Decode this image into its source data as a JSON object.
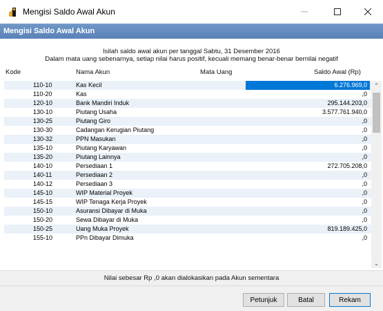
{
  "window": {
    "title": "Mengisi Saldo Awal Akun"
  },
  "header": {
    "title": "Mengisi Saldo Awal Akun"
  },
  "instructions": {
    "line1": "Isilah saldo awal akun per tanggal Sabtu, 31 Desember 2016",
    "line2": "Dalam mata uang sebenarnya, setiap nilai harus positif, kecuali memang benar-benar bernilai negatif"
  },
  "table": {
    "columns": {
      "kode": "Kode",
      "nama": "Nama Akun",
      "mata_uang": "Mata Uang",
      "saldo": "Saldo Awal (Rp)"
    },
    "rows": [
      {
        "kode": "110-10",
        "nama": "Kas Kecil",
        "saldo": "6.276.969,0"
      },
      {
        "kode": "110-20",
        "nama": "Kas",
        "saldo": ",0"
      },
      {
        "kode": "120-10",
        "nama": "Bank Mandiri Induk",
        "saldo": "295.144.203,0"
      },
      {
        "kode": "130-10",
        "nama": "Piutang Usaha",
        "saldo": "3.577.761.940,0"
      },
      {
        "kode": "130-25",
        "nama": "Piutang Giro",
        "saldo": ",0"
      },
      {
        "kode": "130-30",
        "nama": "Cadangan Kerugian Piutang",
        "saldo": ",0"
      },
      {
        "kode": "130-32",
        "nama": "PPN Masukan",
        "saldo": ",0"
      },
      {
        "kode": "135-10",
        "nama": "Piutang Karyawan",
        "saldo": ",0"
      },
      {
        "kode": "135-20",
        "nama": "Piutang Lainnya",
        "saldo": ",0"
      },
      {
        "kode": "140-10",
        "nama": "Persediaan 1",
        "saldo": "272.705.208,0"
      },
      {
        "kode": "140-11",
        "nama": "Persediaan 2",
        "saldo": ",0"
      },
      {
        "kode": "140-12",
        "nama": "Persediaan 3",
        "saldo": ",0"
      },
      {
        "kode": "145-10",
        "nama": "WIP Material Proyek",
        "saldo": ",0"
      },
      {
        "kode": "145-15",
        "nama": "WIP Tenaga Kerja Proyek",
        "saldo": ",0"
      },
      {
        "kode": "150-10",
        "nama": "Asuransi Dibayar di Muka",
        "saldo": ",0"
      },
      {
        "kode": "150-20",
        "nama": "Sewa Dibayar di Muka",
        "saldo": ",0"
      },
      {
        "kode": "150-25",
        "nama": "Uang Muka Proyek",
        "saldo": "819.189.425,0"
      },
      {
        "kode": "155-10",
        "nama": "PPn Dibayar Dimuka",
        "saldo": ",0"
      }
    ]
  },
  "footer": {
    "note": "Nilai sebesar Rp ,0 akan dialokasikan pada Akun sementara"
  },
  "buttons": {
    "petunjuk": "Petunjuk",
    "batal": "Batal",
    "rekam": "Rekam"
  },
  "icons": {
    "app": "app-icon",
    "minimize": "minimize-icon",
    "maximize": "maximize-icon",
    "close": "close-icon",
    "scroll_up": "chevron-up-icon",
    "scroll_down": "chevron-down-icon"
  },
  "colors": {
    "header_band": "#5b82b8",
    "selection": "#0078d7",
    "row_alt": "#eaf1f8"
  }
}
